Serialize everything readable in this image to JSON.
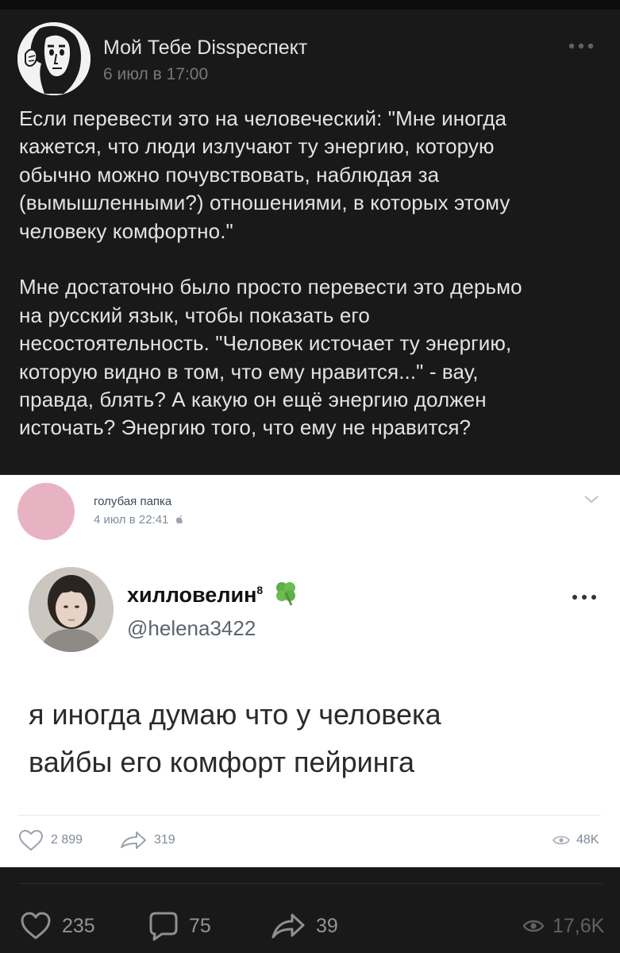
{
  "post": {
    "author": {
      "name": "Мой Тебе Dissреспект",
      "date": "6 июл в 17:00",
      "avatar_icon": "ink-drawing-face-avatar"
    },
    "text": "Если перевести это на человеческий: \"Мне иногда\nкажется, что люди излучают ту энергию, которую\nобычно можно почувствовать, наблюдая за\n(вымышленными?) отношениями, в которых этому\nчеловеку комфортно.\"\n\nМне достаточно было просто перевести это дерьмо\nна русский язык, чтобы показать его\nнесостоятельность. \"Человек источает ту энергию,\nкоторую видно в том, что ему нравится...\" - вау,\nправда, блять? А какую он ещё энергию должен\nисточать? Энергию того, что ему не нравится?",
    "menu_icon": "more-horizontal-icon"
  },
  "repost": {
    "author": {
      "name": "голубая папка",
      "date": "4 июл в 22:41",
      "avatar_color": "#e7b3c3"
    },
    "tweet": {
      "name": "хилловелин",
      "superscript": "8",
      "emoji": "four-leaf-clover",
      "handle": "@helena3422",
      "text": "я иногда думаю что у человека\nвайбы его комфорт пейринга"
    },
    "stats": {
      "likes": "2 899",
      "shares": "319",
      "views": "48K"
    }
  },
  "actions": {
    "likes": "235",
    "comments": "75",
    "shares": "39",
    "views": "17,6K"
  },
  "colors": {
    "dark_bg": "#19191a",
    "text_light": "#e1e3e6",
    "muted": "#76787a"
  }
}
